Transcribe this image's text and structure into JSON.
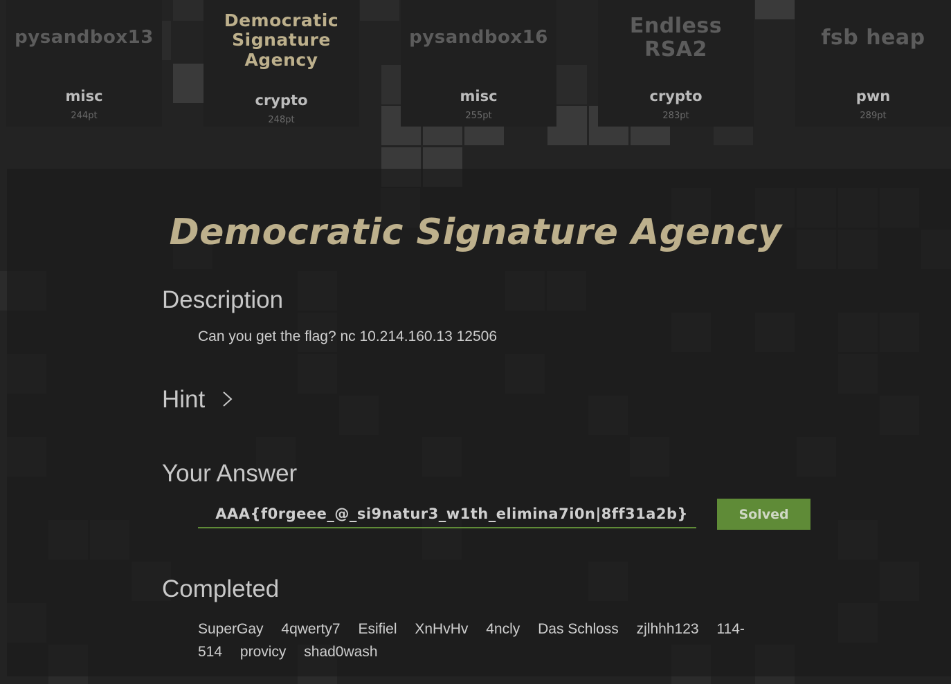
{
  "cards": [
    {
      "title": [
        "pysandbox13"
      ],
      "category": "misc",
      "points": "244pt"
    },
    {
      "title": [
        "Democratic",
        "Signature",
        "Agency"
      ],
      "category": "crypto",
      "points": "248pt"
    },
    {
      "title": [
        "pysandbox16"
      ],
      "category": "misc",
      "points": "255pt"
    },
    {
      "title": [
        "Endless",
        "RSA2"
      ],
      "category": "crypto",
      "points": "283pt"
    },
    {
      "title": [
        "fsb heap"
      ],
      "category": "pwn",
      "points": "289pt"
    }
  ],
  "challenge": {
    "title": "Democratic Signature Agency",
    "description_heading": "Description",
    "description_text": "Can you get the flag?  nc 10.214.160.13 12506",
    "hint_heading": "Hint",
    "answer_heading": "Your Answer",
    "answer_value": "AAA{f0rgeee_@_si9natur3_w1th_elimina7i0n|8ff31a2b}",
    "submit_label": "Solved",
    "completed_heading": "Completed",
    "completed_users": [
      "SuperGay",
      "4qwerty7",
      "Esifiel",
      "XnHvHv",
      "4ncly",
      "Das Schloss",
      "zjlhhh123",
      "114-514",
      "provicy",
      "shad0wash"
    ]
  },
  "colors": {
    "accent_gold": "#bdb08c",
    "solved_green": "#5f8b37",
    "background": "#232323"
  },
  "icons": {
    "hint_toggle": "chevron-right-icon"
  }
}
